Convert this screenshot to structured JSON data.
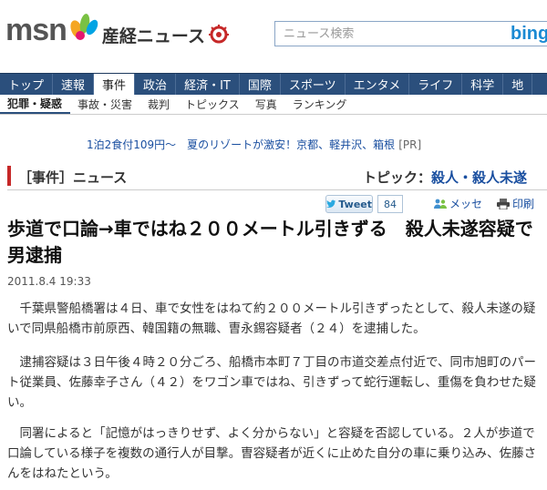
{
  "header": {
    "logo_msn": "msn",
    "logo_sankei": "産経ニュース",
    "search_placeholder": "ニュース検索",
    "bing_label": "bing"
  },
  "nav": {
    "items": [
      "トップ",
      "速報",
      "事件",
      "政治",
      "経済・IT",
      "国際",
      "スポーツ",
      "エンタメ",
      "ライフ",
      "科学",
      "地"
    ],
    "active_index": 2
  },
  "subnav": {
    "items": [
      "犯罪・疑惑",
      "事故・災害",
      "裁判",
      "トピックス",
      "写真",
      "ランキング"
    ],
    "active_index": 0
  },
  "ad": {
    "text": "1泊2食付109円～　夏のリゾートが激安！京都、軽井沢、箱根",
    "pr": "[PR]"
  },
  "section": {
    "title": "［事件］ニュース",
    "topic_label": "トピック：",
    "topic_link": "殺人・殺人未遂"
  },
  "share": {
    "tweet_label": "Tweet",
    "tweet_count": "84",
    "memo_label": "メッセ",
    "print_label": "印刷"
  },
  "article": {
    "headline": "歩道で口論→車ではね２００メートル引きずる　殺人未遂容疑で男逮捕",
    "date": "2011.8.4 19:33",
    "paragraphs": [
      "　千葉県警船橋署は４日、車で女性をはねて約２００メートル引きずったとして、殺人未遂の疑いで同県船橋市前原西、韓国籍の無職、曺永錫容疑者（２４）を逮捕した。",
      "　逮捕容疑は３日午後４時２０分ごろ、船橋市本町７丁目の市道交差点付近で、同市旭町のパート従業員、佐藤幸子さん（４２）をワゴン車ではね、引きずって蛇行運転し、重傷を負わせた疑い。",
      "　同署によると「記憶がはっきりせず、よく分からない」と容疑を否認している。２人が歩道で口論している様子を複数の通行人が目撃。曺容疑者が近くに止めた自分の車に乗り込み、佐藤さんをはねたという。"
    ]
  }
}
